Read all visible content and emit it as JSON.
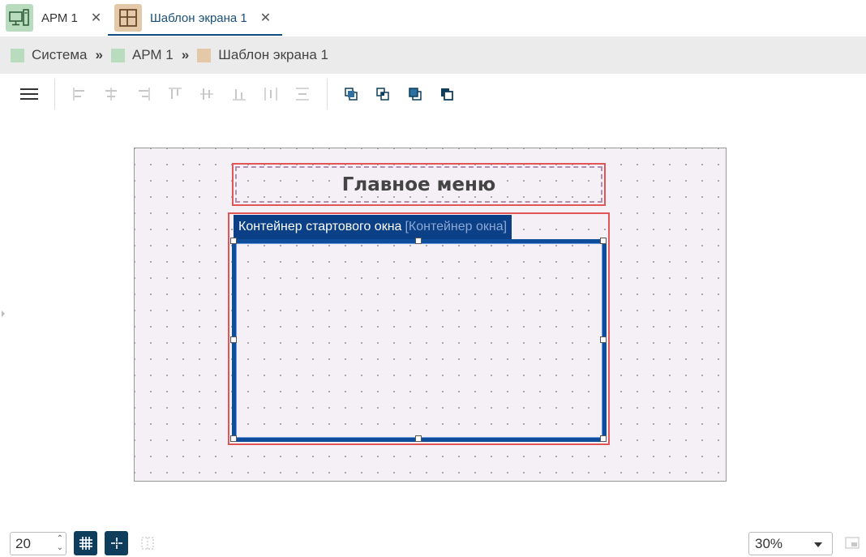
{
  "tabs": [
    {
      "label": "АРМ 1",
      "icon": "workstation-icon",
      "icon_bg": "#b9dcbf"
    },
    {
      "label": "Шаблон экрана 1",
      "icon": "layout-grid-icon",
      "icon_bg": "#e4c9a8",
      "active": true
    }
  ],
  "breadcrumb": [
    {
      "label": "Система",
      "color": "#b9dcbf"
    },
    {
      "label": "АРМ 1",
      "color": "#b9dcbf"
    },
    {
      "label": "Шаблон экрана 1",
      "color": "#e4c9a8"
    }
  ],
  "breadcrumb_separator": "»",
  "toolbar": {
    "menu_icon": "hamburger-icon",
    "align_icons": [
      "align-left-icon",
      "align-center-horizontal-icon",
      "align-right-icon",
      "align-top-icon",
      "align-center-vertical-icon",
      "align-bottom-icon",
      "distribute-horizontal-icon",
      "distribute-vertical-icon"
    ],
    "order_icons": [
      "bring-to-front-icon",
      "bring-forward-icon",
      "send-backward-icon",
      "send-to-back-icon"
    ]
  },
  "canvas": {
    "title": "Главное меню",
    "container_name": "Контейнер стартового окна",
    "container_type": "[Контейнер окна]"
  },
  "bottom": {
    "grid_size": "20",
    "zoom": "30%"
  },
  "colors": {
    "accent": "#0f4c81",
    "selection": "#e05555",
    "container": "#0f4c9a",
    "canvas_bg": "#f4f0f6"
  }
}
